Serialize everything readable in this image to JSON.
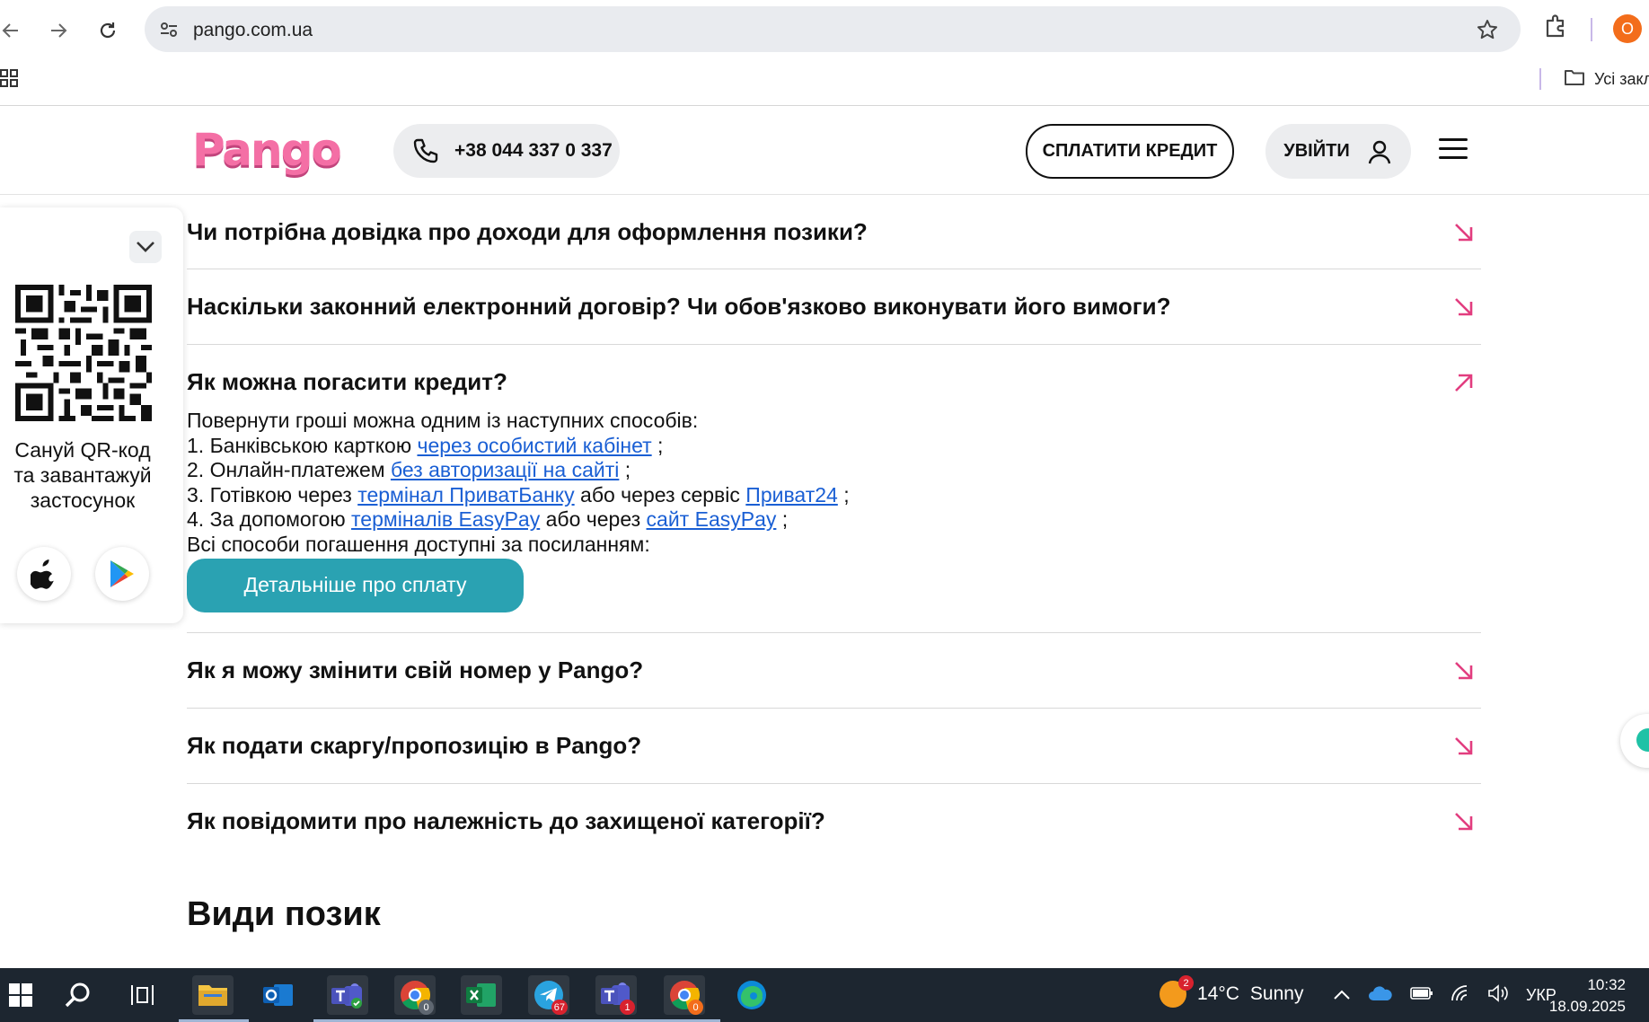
{
  "browser": {
    "url": "pango.com.ua",
    "profile_initial": "O",
    "bookmarks_folder": "Усі закладки"
  },
  "header": {
    "logo_text": "Pango",
    "phone": "+38 044 337 0 337",
    "pay_label": "СПЛАТИТИ КРЕДИТ",
    "login_label": "УВІЙТИ"
  },
  "qr_panel": {
    "text": "Сануй QR-код та завантажуй застосунок"
  },
  "faq": {
    "q1": "Чи потрібна довідка про доходи для оформлення позики?",
    "q2": "Наскільки законний електронний договір? Чи обов'язково виконувати його вимоги?",
    "q3": "Як можна погасити кредит?",
    "answer": {
      "intro": "Повернути гроші можна одним із наступних способів:",
      "l1_text": "1. Банківською карткою ",
      "l1_link": "через особистий кабінет",
      "l1_end": " ;",
      "l2_text": "2. Онлайн-платежем ",
      "l2_link": "без авторизації на сайті",
      "l2_end": " ;",
      "l3_text": "3. Готівкою через ",
      "l3_link1": "термінал ПриватБанку",
      "l3_mid": " або через сервіс ",
      "l3_link2": "Приват24",
      "l3_end": " ;",
      "l4_text": "4. За допомогою ",
      "l4_link1": "терміналів EasyPay",
      "l4_mid": " або через ",
      "l4_link2": "сайт EasyPay",
      "l4_end": " ;",
      "outro": "Всі способи погашення доступні за посиланням:",
      "button": "Детальніше про сплату"
    },
    "q4": "Як я можу змінити свій номер у Pango?",
    "q5": "Як подати скаргу/пропозицію в Pango?",
    "q6": "Як повідомити про належність до захищеної категорії?"
  },
  "section_title": "Види позик",
  "taskbar": {
    "chrome_badge": "0",
    "telegram_badge": "67",
    "teams_badge": "1",
    "chrome2_badge": "0",
    "weather_badge": "2",
    "temperature": "14°C",
    "weather": "Sunny",
    "language": "УКР",
    "time": "10:32",
    "date": "18.09.2025"
  },
  "colors": {
    "brand_pink": "#f46fa5",
    "accent_teal": "#2aa2b2",
    "link_blue": "#1a5fd4",
    "taskbar_bg": "#1d2630"
  }
}
